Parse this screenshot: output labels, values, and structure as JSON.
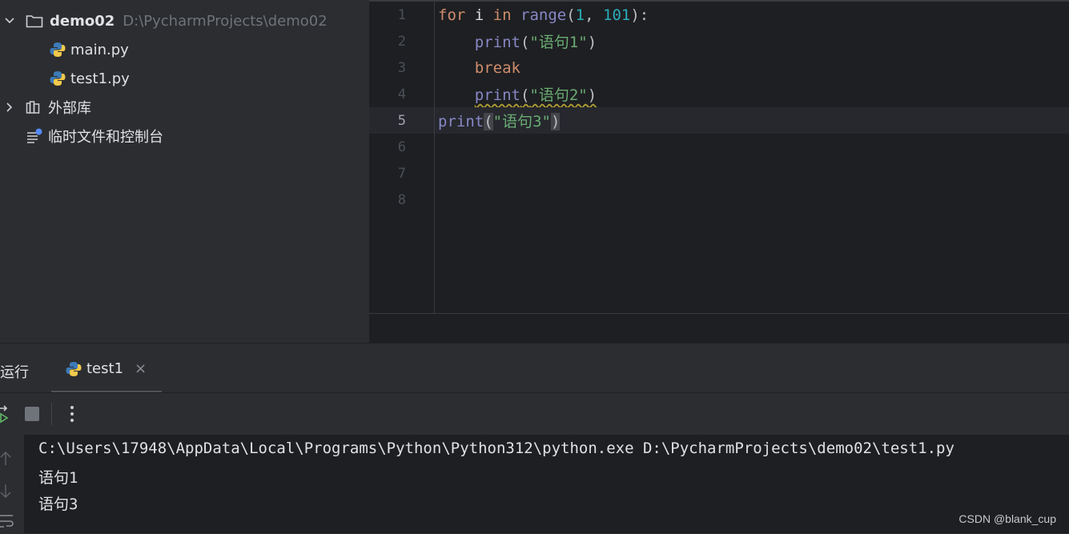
{
  "project": {
    "root_name": "demo02",
    "root_path": "D:\\PycharmProjects\\demo02",
    "files": [
      "main.py",
      "test1.py"
    ],
    "external_libs": "外部库",
    "scratches": "临时文件和控制台"
  },
  "editor": {
    "line_numbers": [
      "1",
      "2",
      "3",
      "4",
      "5",
      "6",
      "7",
      "8"
    ],
    "current_line": "5"
  },
  "run": {
    "title": "运行",
    "tab_label": "test1",
    "close": "×",
    "output": [
      "C:\\Users\\17948\\AppData\\Local\\Programs\\Python\\Python312\\python.exe D:\\PycharmProjects\\demo02\\test1.py",
      "语句1",
      "语句3"
    ]
  },
  "watermark": "CSDN @blank_cup",
  "colors": {
    "keyword": "#cf8e6d",
    "builtin": "#8888c6",
    "number": "#2aacb8",
    "string": "#6aab73",
    "python_blue": "#3d7ab8",
    "python_yellow": "#f2c94c"
  }
}
